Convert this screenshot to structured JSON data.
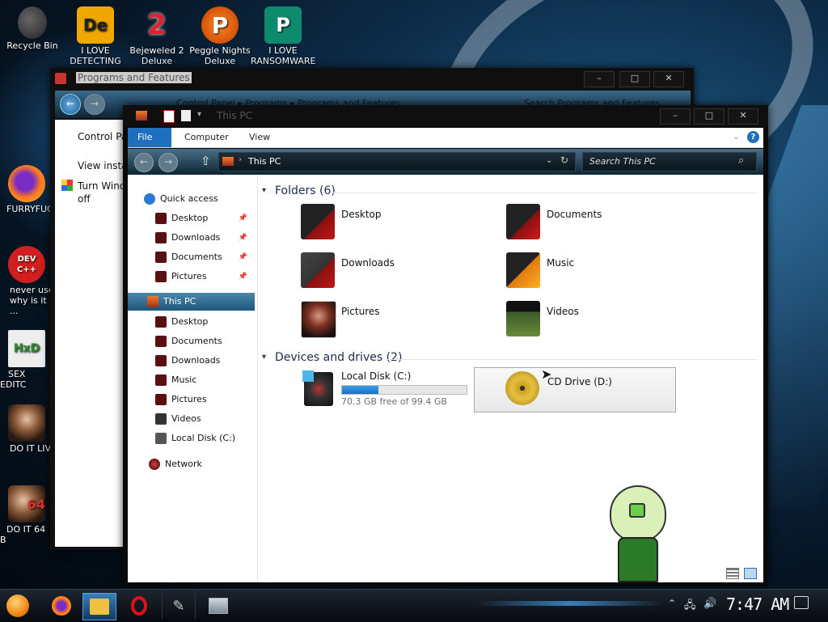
{
  "desktop": {
    "icons_top": [
      {
        "label": "Recycle Bin"
      },
      {
        "label": "I LOVE DETECTING",
        "glyph": "De"
      },
      {
        "label": "Bejeweled 2 Deluxe",
        "glyph": "2"
      },
      {
        "label": "Peggle Nights Deluxe",
        "glyph": "P"
      },
      {
        "label": "I LOVE RANSOMWARE",
        "glyph": "P"
      }
    ],
    "icons_left": [
      {
        "label": "FURRYFUC"
      },
      {
        "label": "never use why is it ...",
        "glyph": "DEV C++"
      },
      {
        "label": "SEX EDITC",
        "glyph": "HxD"
      },
      {
        "label": "DO IT LIV"
      },
      {
        "label": "DO IT 64 B",
        "glyph": "64"
      }
    ]
  },
  "programs_window": {
    "title": "Programs and Features",
    "breadcrumb": "Control Panel ▸ Programs ▸ Programs and Features",
    "search_placeholder": "Search Programs and Features",
    "sidebar": {
      "item1": "Control Pa",
      "item2": "View insta",
      "item3_line1": "Turn Wind",
      "item3_line2": "off"
    }
  },
  "thispc_window": {
    "title": "This PC",
    "ribbon_tabs": [
      "File",
      "Computer",
      "View"
    ],
    "address": "This PC",
    "search_placeholder": "Search This PC",
    "nav": {
      "quick_access": "Quick access",
      "qa_items": [
        "Desktop",
        "Downloads",
        "Documents",
        "Pictures"
      ],
      "this_pc": "This PC",
      "pc_items": [
        "Desktop",
        "Documents",
        "Downloads",
        "Music",
        "Pictures",
        "Videos",
        "Local Disk (C:)"
      ],
      "network": "Network"
    },
    "folders_header": "Folders (6)",
    "folders": [
      "Desktop",
      "Documents",
      "Downloads",
      "Music",
      "Pictures",
      "Videos"
    ],
    "devices_header": "Devices and drives (2)",
    "local_disk": {
      "name": "Local Disk (C:)",
      "free_text": "70.3 GB free of 99.4 GB",
      "used_fraction": 0.29
    },
    "cd_drive": {
      "name": "CD Drive (D:)"
    }
  },
  "taskbar": {
    "time": "7:47 AM"
  },
  "colors": {
    "accent": "#1e6fc0",
    "header": "#1d2a4e",
    "selection": "#2a6a92"
  }
}
